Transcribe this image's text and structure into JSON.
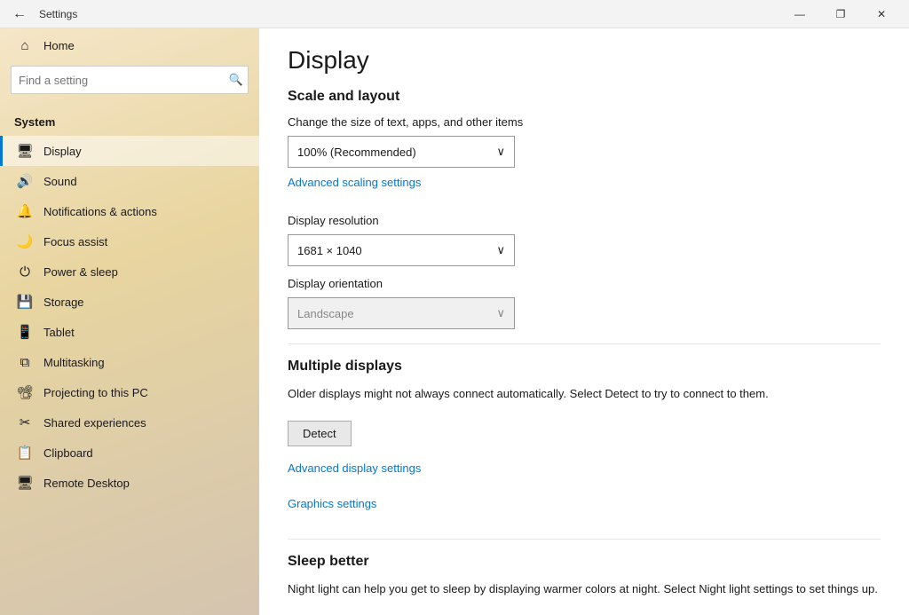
{
  "titlebar": {
    "title": "Settings",
    "back_label": "←",
    "minimize": "—",
    "maximize": "❐",
    "close": "✕"
  },
  "sidebar": {
    "home_label": "Home",
    "system_label": "System",
    "search_placeholder": "Find a setting",
    "items": [
      {
        "id": "display",
        "label": "Display",
        "icon": "🖥"
      },
      {
        "id": "sound",
        "label": "Sound",
        "icon": "🔊"
      },
      {
        "id": "notifications",
        "label": "Notifications & actions",
        "icon": "🔔"
      },
      {
        "id": "focus",
        "label": "Focus assist",
        "icon": "🌙"
      },
      {
        "id": "power",
        "label": "Power & sleep",
        "icon": "⏻"
      },
      {
        "id": "storage",
        "label": "Storage",
        "icon": "💾"
      },
      {
        "id": "tablet",
        "label": "Tablet",
        "icon": "📱"
      },
      {
        "id": "multitasking",
        "label": "Multitasking",
        "icon": "⧉"
      },
      {
        "id": "projecting",
        "label": "Projecting to this PC",
        "icon": "📽"
      },
      {
        "id": "shared",
        "label": "Shared experiences",
        "icon": "✂"
      },
      {
        "id": "clipboard",
        "label": "Clipboard",
        "icon": "📋"
      },
      {
        "id": "remote",
        "label": "Remote Desktop",
        "icon": "🖥"
      }
    ]
  },
  "content": {
    "page_title": "Display",
    "scale_section": "Scale and layout",
    "scale_label": "Change the size of text, apps, and other items",
    "scale_value": "100% (Recommended)",
    "scale_link": "Advanced scaling settings",
    "resolution_label": "Display resolution",
    "resolution_value": "1681 × 1040",
    "orientation_label": "Display orientation",
    "orientation_value": "Landscape",
    "multiple_section": "Multiple displays",
    "multiple_desc": "Older displays might not always connect automatically. Select Detect to try to connect to them.",
    "detect_btn": "Detect",
    "advanced_display_link": "Advanced display settings",
    "graphics_link": "Graphics settings",
    "sleep_section": "Sleep better",
    "sleep_desc": "Night light can help you get to sleep by displaying warmer colors at night. Select Night light settings to set things up."
  }
}
